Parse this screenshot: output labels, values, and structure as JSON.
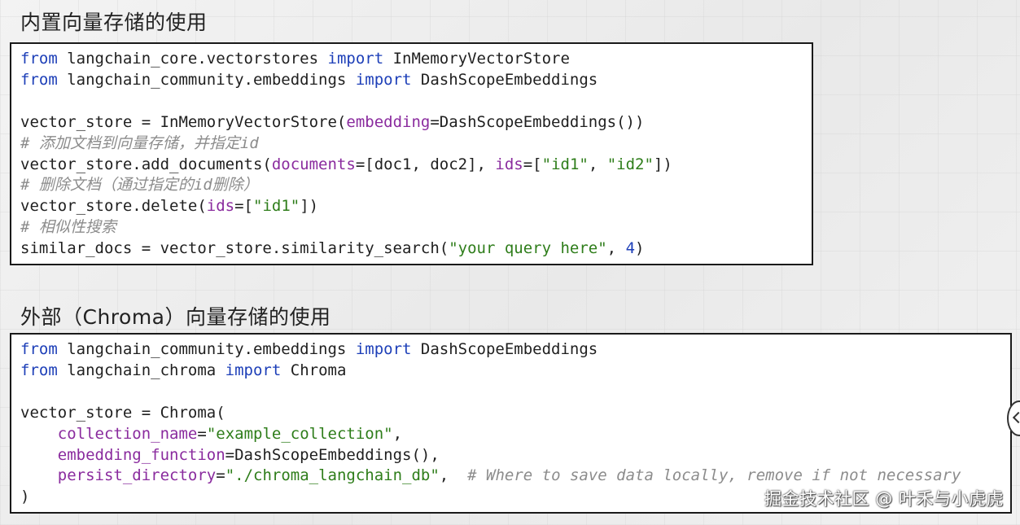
{
  "sections": [
    {
      "heading": "内置向量存储的使用",
      "code": [
        [
          {
            "t": "from",
            "c": "kw"
          },
          {
            "t": " langchain_core.vectorstores "
          },
          {
            "t": "import",
            "c": "kw"
          },
          {
            "t": " InMemoryVectorStore"
          }
        ],
        [
          {
            "t": "from",
            "c": "kw"
          },
          {
            "t": " langchain_community.embeddings "
          },
          {
            "t": "import",
            "c": "kw"
          },
          {
            "t": " DashScopeEmbeddings"
          }
        ],
        [],
        [
          {
            "t": "vector_store = InMemoryVectorStore("
          },
          {
            "t": "embedding",
            "c": "param"
          },
          {
            "t": "=DashScopeEmbeddings())"
          }
        ],
        [
          {
            "t": "# 添加文档到向量存储，并指定id",
            "c": "cm"
          }
        ],
        [
          {
            "t": "vector_store.add_documents("
          },
          {
            "t": "documents",
            "c": "param"
          },
          {
            "t": "=[doc1, doc2], "
          },
          {
            "t": "ids",
            "c": "param"
          },
          {
            "t": "=["
          },
          {
            "t": "\"id1\"",
            "c": "str"
          },
          {
            "t": ", "
          },
          {
            "t": "\"id2\"",
            "c": "str"
          },
          {
            "t": "])"
          }
        ],
        [
          {
            "t": "# 删除文档（通过指定的id删除）",
            "c": "cm"
          }
        ],
        [
          {
            "t": "vector_store.delete("
          },
          {
            "t": "ids",
            "c": "param"
          },
          {
            "t": "=["
          },
          {
            "t": "\"id1\"",
            "c": "str"
          },
          {
            "t": "])"
          }
        ],
        [
          {
            "t": "# 相似性搜索",
            "c": "cm"
          }
        ],
        [
          {
            "t": "similar_docs = vector_store.similarity_search("
          },
          {
            "t": "\"your query here\"",
            "c": "str"
          },
          {
            "t": ", "
          },
          {
            "t": "4",
            "c": "num"
          },
          {
            "t": ")"
          }
        ]
      ]
    },
    {
      "heading": "外部（Chroma）向量存储的使用",
      "code": [
        [
          {
            "t": "from",
            "c": "kw"
          },
          {
            "t": " langchain_community.embeddings "
          },
          {
            "t": "import",
            "c": "kw"
          },
          {
            "t": " DashScopeEmbeddings"
          }
        ],
        [
          {
            "t": "from",
            "c": "kw"
          },
          {
            "t": " langchain_chroma "
          },
          {
            "t": "import",
            "c": "kw"
          },
          {
            "t": " Chroma"
          }
        ],
        [],
        [
          {
            "t": "vector_store = Chroma("
          }
        ],
        [
          {
            "t": "    "
          },
          {
            "t": "collection_name",
            "c": "param"
          },
          {
            "t": "="
          },
          {
            "t": "\"example_collection\"",
            "c": "str"
          },
          {
            "t": ","
          }
        ],
        [
          {
            "t": "    "
          },
          {
            "t": "embedding_function",
            "c": "param"
          },
          {
            "t": "=DashScopeEmbeddings(),"
          }
        ],
        [
          {
            "t": "    "
          },
          {
            "t": "persist_directory",
            "c": "param"
          },
          {
            "t": "="
          },
          {
            "t": "\"./chroma_langchain_db\"",
            "c": "str"
          },
          {
            "t": ",  "
          },
          {
            "t": "# Where to save data locally, remove if not necessary",
            "c": "cm"
          }
        ],
        [
          {
            "t": ")"
          }
        ]
      ]
    }
  ],
  "watermark": "掘金技术社区 @ 叶禾与小虎虎"
}
